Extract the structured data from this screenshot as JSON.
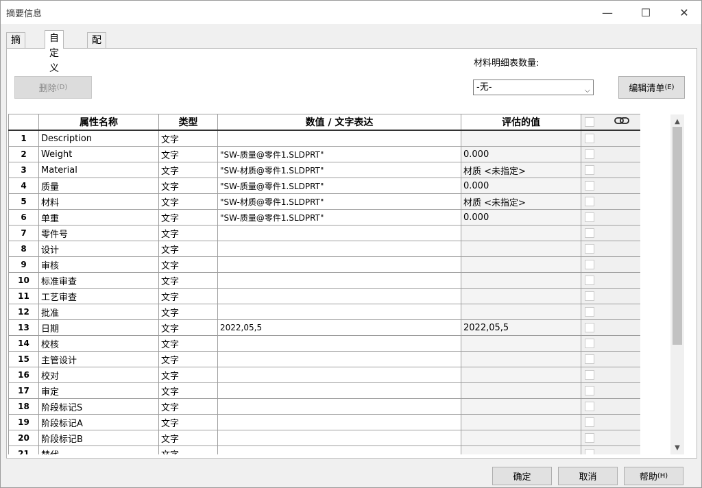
{
  "window": {
    "title": "摘要信息"
  },
  "tabs": [
    {
      "label": "摘要"
    },
    {
      "label": "自定义"
    },
    {
      "label": "配置特定"
    }
  ],
  "toolbar": {
    "delete_label": "删除",
    "delete_shortcut": "(D)",
    "bom_qty_label": "材料明细表数量:",
    "bom_qty_value": "-无-",
    "edit_list_label": "编辑清单",
    "edit_list_shortcut": "(E)"
  },
  "columns": {
    "prop": "属性名称",
    "type": "类型",
    "expr": "数值 / 文字表达",
    "eval": "评估的值"
  },
  "rows": [
    {
      "n": "1",
      "name": "Description",
      "type": "文字",
      "expr": "",
      "eval": ""
    },
    {
      "n": "2",
      "name": "Weight",
      "type": "文字",
      "expr": "\"SW-质量@零件1.SLDPRT\"",
      "eval": "0.000"
    },
    {
      "n": "3",
      "name": "Material",
      "type": "文字",
      "expr": "\"SW-材质@零件1.SLDPRT\"",
      "eval": "材质 <未指定>"
    },
    {
      "n": "4",
      "name": "质量",
      "type": "文字",
      "expr": "\"SW-质量@零件1.SLDPRT\"",
      "eval": "0.000"
    },
    {
      "n": "5",
      "name": "材料",
      "type": "文字",
      "expr": "\"SW-材质@零件1.SLDPRT\"",
      "eval": "材质 <未指定>"
    },
    {
      "n": "6",
      "name": "单重",
      "type": "文字",
      "expr": "\"SW-质量@零件1.SLDPRT\"",
      "eval": "0.000"
    },
    {
      "n": "7",
      "name": "零件号",
      "type": "文字",
      "expr": "",
      "eval": ""
    },
    {
      "n": "8",
      "name": "设计",
      "type": "文字",
      "expr": "",
      "eval": ""
    },
    {
      "n": "9",
      "name": "审核",
      "type": "文字",
      "expr": "",
      "eval": ""
    },
    {
      "n": "10",
      "name": "标准审查",
      "type": "文字",
      "expr": "",
      "eval": ""
    },
    {
      "n": "11",
      "name": "工艺审查",
      "type": "文字",
      "expr": "",
      "eval": ""
    },
    {
      "n": "12",
      "name": "批准",
      "type": "文字",
      "expr": "",
      "eval": ""
    },
    {
      "n": "13",
      "name": "日期",
      "type": "文字",
      "expr": "2022,05,5",
      "eval": "2022,05,5"
    },
    {
      "n": "14",
      "name": "校核",
      "type": "文字",
      "expr": "",
      "eval": ""
    },
    {
      "n": "15",
      "name": "主管设计",
      "type": "文字",
      "expr": "",
      "eval": ""
    },
    {
      "n": "16",
      "name": "校对",
      "type": "文字",
      "expr": "",
      "eval": ""
    },
    {
      "n": "17",
      "name": "审定",
      "type": "文字",
      "expr": "",
      "eval": ""
    },
    {
      "n": "18",
      "name": "阶段标记S",
      "type": "文字",
      "expr": "",
      "eval": ""
    },
    {
      "n": "19",
      "name": "阶段标记A",
      "type": "文字",
      "expr": "",
      "eval": ""
    },
    {
      "n": "20",
      "name": "阶段标记B",
      "type": "文字",
      "expr": "",
      "eval": ""
    },
    {
      "n": "21",
      "name": "替代",
      "type": "文字",
      "expr": "",
      "eval": ""
    }
  ],
  "footer": {
    "ok_label": "确定",
    "cancel_label": "取消",
    "help_label": "帮助",
    "help_shortcut": "(H)"
  }
}
